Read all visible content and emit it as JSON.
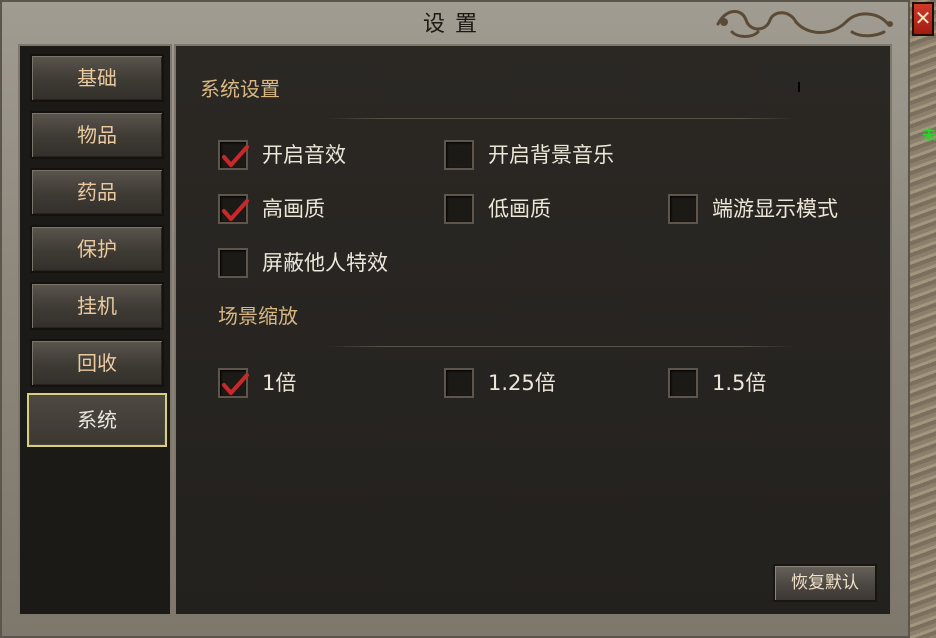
{
  "window": {
    "title": "设置",
    "close_symbol": "✕"
  },
  "side_text": "未",
  "sidebar": {
    "items": [
      {
        "label": "基础",
        "active": false
      },
      {
        "label": "物品",
        "active": false
      },
      {
        "label": "药品",
        "active": false
      },
      {
        "label": "保护",
        "active": false
      },
      {
        "label": "挂机",
        "active": false
      },
      {
        "label": "回收",
        "active": false
      },
      {
        "label": "系统",
        "active": true
      }
    ]
  },
  "system_settings": {
    "title": "系统设置",
    "options": [
      {
        "label": "开启音效",
        "checked": true
      },
      {
        "label": "开启背景音乐",
        "checked": false
      },
      {
        "label": "高画质",
        "checked": true
      },
      {
        "label": "低画质",
        "checked": false
      },
      {
        "label": "端游显示模式",
        "checked": false
      },
      {
        "label": "屏蔽他人特效",
        "checked": false
      }
    ]
  },
  "scene_zoom": {
    "title": "场景缩放",
    "options": [
      {
        "label": "1倍",
        "checked": true
      },
      {
        "label": "1.25倍",
        "checked": false
      },
      {
        "label": "1.5倍",
        "checked": false
      }
    ]
  },
  "reset_button": {
    "label": "恢复默认"
  },
  "icons": {
    "check": "check-icon",
    "close": "close-icon",
    "decoration": "dragon-ornament-icon"
  },
  "colors": {
    "check_red": "#c8282a",
    "section_gold": "#d8b782",
    "active_border": "#d7d080",
    "nav_text": "#ebcaa0",
    "panel_bg": "#23211e"
  }
}
